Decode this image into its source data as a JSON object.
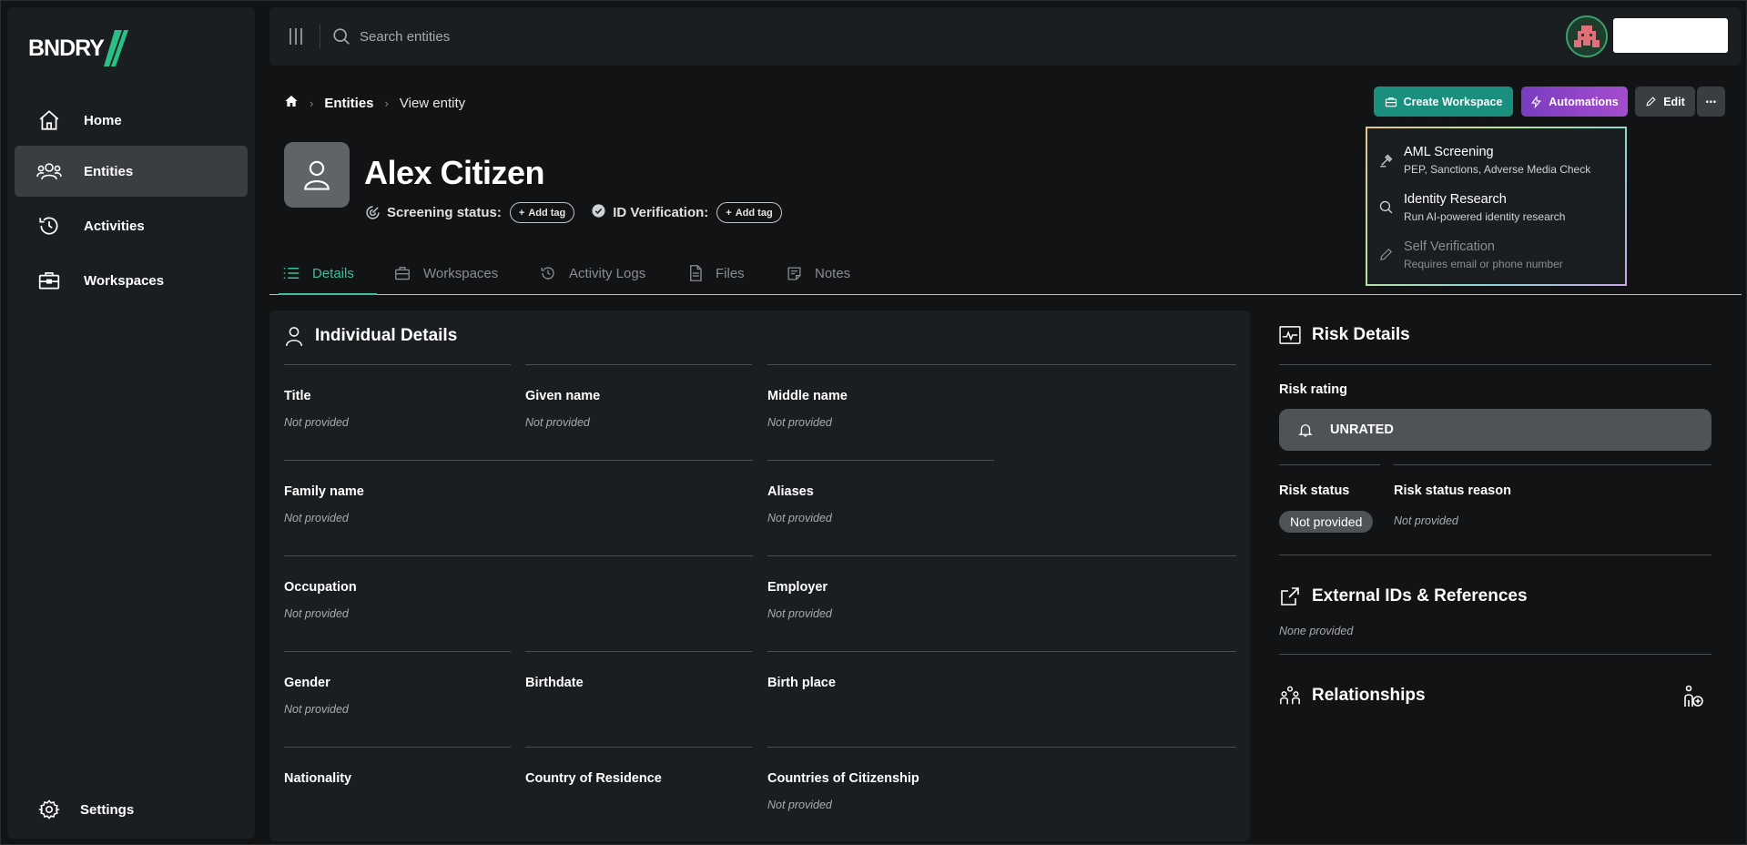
{
  "app": {
    "logo_text": "BNDRY"
  },
  "sidebar": {
    "items": [
      {
        "label": "Home",
        "icon": "home-icon"
      },
      {
        "label": "Entities",
        "icon": "users-icon",
        "active": true
      },
      {
        "label": "Activities",
        "icon": "history-icon"
      },
      {
        "label": "Workspaces",
        "icon": "briefcase-icon"
      }
    ],
    "settings_label": "Settings"
  },
  "topbar": {
    "search_placeholder": "Search entities"
  },
  "breadcrumb": {
    "entities": "Entities",
    "current": "View entity"
  },
  "actions": {
    "create_workspace": "Create Workspace",
    "automations": "Automations",
    "edit": "Edit",
    "more": "⋯"
  },
  "automations_menu": [
    {
      "title": "AML Screening",
      "subtitle": "PEP, Sanctions, Adverse Media Check",
      "icon": "gavel-icon",
      "disabled": false
    },
    {
      "title": "Identity Research",
      "subtitle": "Run AI-powered identity research",
      "icon": "search-icon",
      "disabled": false
    },
    {
      "title": "Self Verification",
      "subtitle": "Requires email or phone number",
      "icon": "pencil-icon",
      "disabled": true
    }
  ],
  "entity": {
    "name": "Alex Citizen",
    "screening_status_label": "Screening status:",
    "id_verification_label": "ID Verification:",
    "add_tag_label": "Add tag"
  },
  "tabs": [
    "Details",
    "Workspaces",
    "Activity Logs",
    "Files",
    "Notes"
  ],
  "individual_details": {
    "title": "Individual Details",
    "fields": {
      "title": {
        "label": "Title",
        "value": "Not provided"
      },
      "given_name": {
        "label": "Given name",
        "value": "Not provided"
      },
      "middle_name": {
        "label": "Middle name",
        "value": "Not provided"
      },
      "family_name": {
        "label": "Family name",
        "value": "Not provided"
      },
      "aliases": {
        "label": "Aliases",
        "value": "Not provided"
      },
      "occupation": {
        "label": "Occupation",
        "value": "Not provided"
      },
      "employer": {
        "label": "Employer",
        "value": "Not provided"
      },
      "gender": {
        "label": "Gender",
        "value": "Not provided"
      },
      "birthdate": {
        "label": "Birthdate",
        "value": ""
      },
      "birth_place": {
        "label": "Birth place",
        "value": ""
      },
      "nationality": {
        "label": "Nationality",
        "value": ""
      },
      "country_of_residence": {
        "label": "Country of Residence",
        "value": ""
      },
      "countries_of_citizenship": {
        "label": "Countries of Citizenship",
        "value": "Not provided"
      }
    }
  },
  "risk_details": {
    "title": "Risk Details",
    "risk_rating_label": "Risk rating",
    "risk_rating_value": "UNRATED",
    "risk_status_label": "Risk status",
    "risk_status_value": "Not provided",
    "risk_status_reason_label": "Risk status reason",
    "risk_status_reason_value": "Not provided"
  },
  "external_ids": {
    "title": "External IDs & References",
    "value": "None provided"
  },
  "relationships": {
    "title": "Relationships"
  },
  "colors": {
    "accent_teal": "#1a8f7e",
    "accent_purple": "#8a44c8",
    "tab_active": "#3fbf9a",
    "background": "#111315",
    "panel": "#1b1e21"
  }
}
